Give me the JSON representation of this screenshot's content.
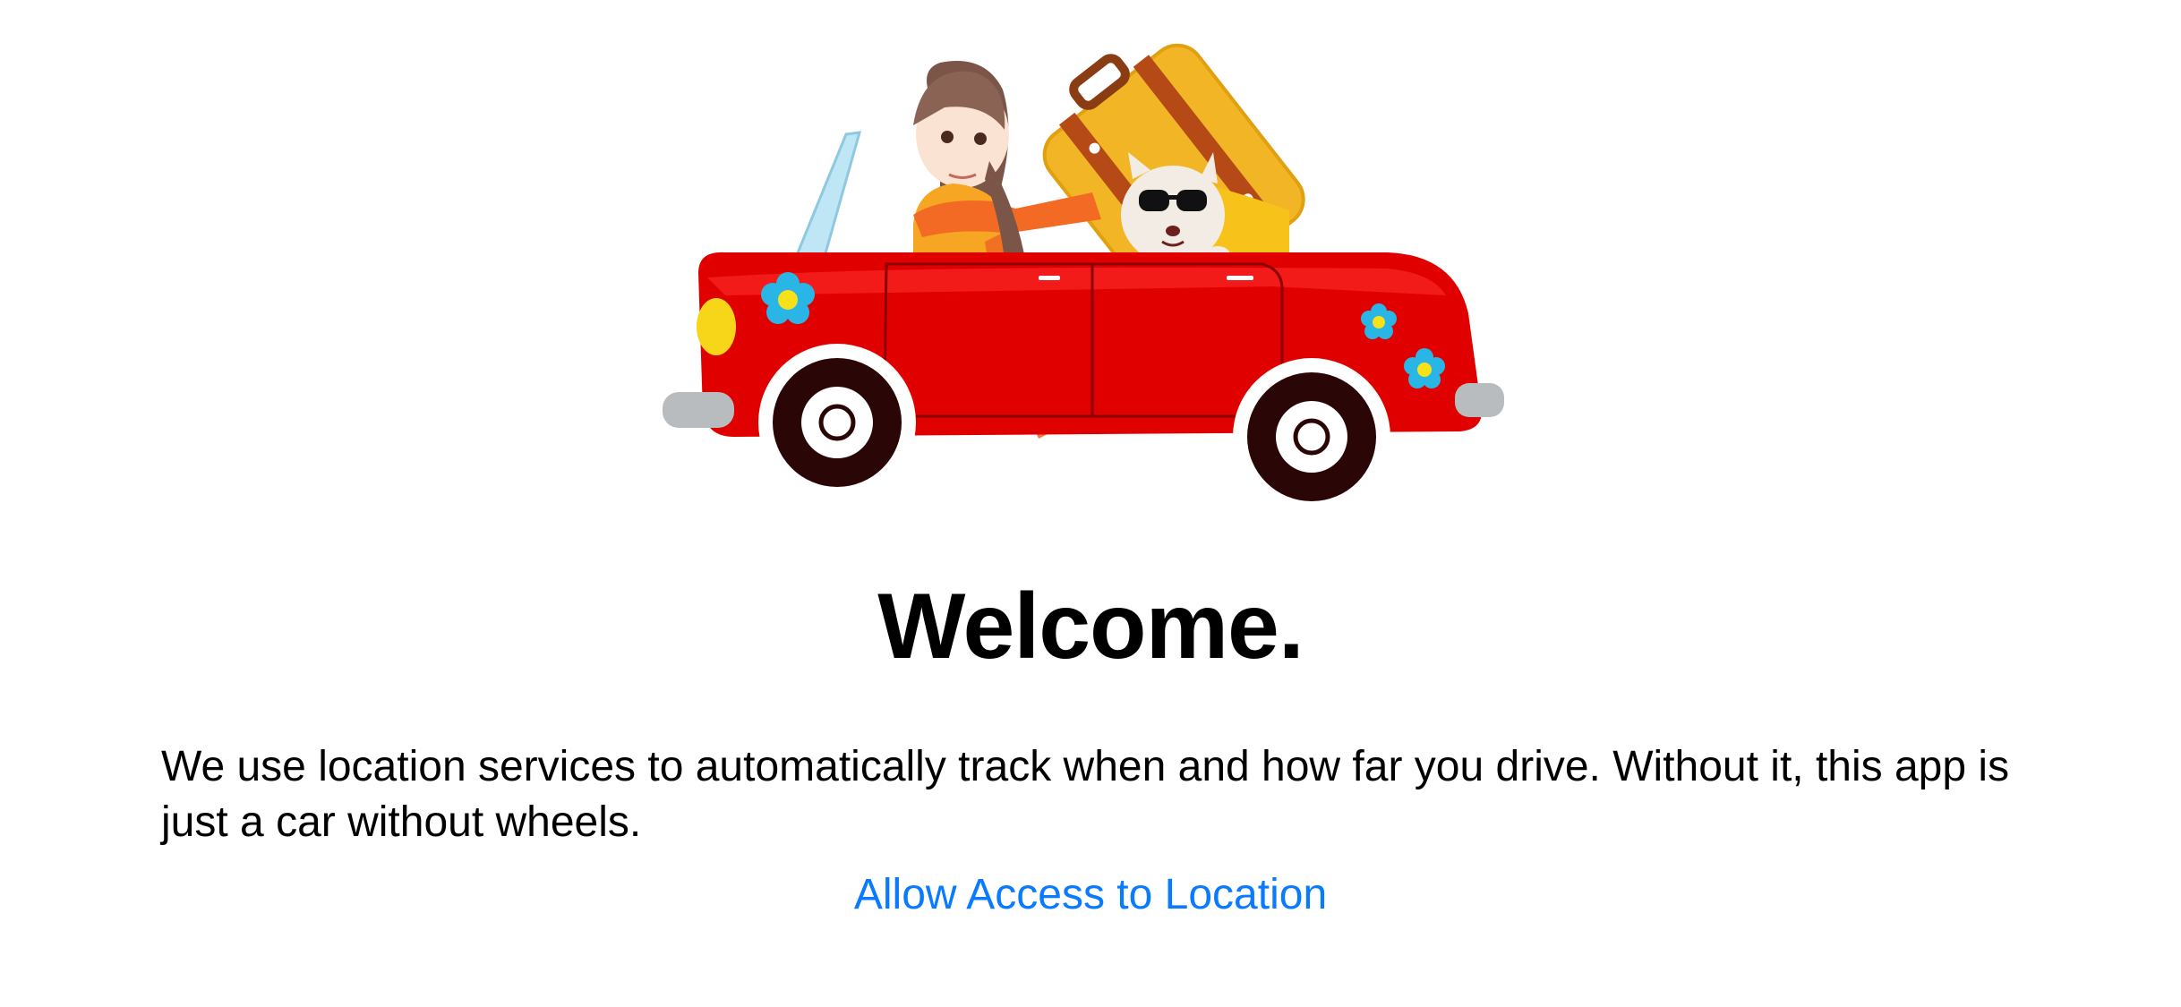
{
  "onboarding": {
    "title": "Welcome.",
    "description": "We use location services to automatically track when and how far you drive. Without it, this app is just a car without wheels.",
    "allow_location_label": "Allow Access to Location"
  },
  "illustration": {
    "icon": "car-with-girl-and-dog-illustration"
  },
  "colors": {
    "accent": "#0a7aff",
    "car_body": "#e00000",
    "suitcase": "#f2b526",
    "flower": "#29b6e6",
    "text": "#000000",
    "background": "#ffffff"
  }
}
